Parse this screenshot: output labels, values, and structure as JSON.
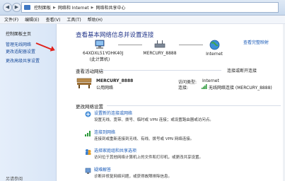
{
  "window": {
    "breadcrumb": [
      "控制面板",
      "网络和 Internet",
      "网络和共享中心"
    ]
  },
  "menu": [
    "文件(F)",
    "编辑(E)",
    "查看(V)",
    "工具(T)",
    "帮助(H)"
  ],
  "sidebar": {
    "items": [
      "控制面板主页",
      "管理无线网络",
      "更改适配器设置",
      "更改高级共享设置"
    ],
    "see_also": "另请参阅"
  },
  "main": {
    "title": "查看基本网络信息并设置连接",
    "full_map": "查看完整映射",
    "map": {
      "computer": "64XDXL51YOHK40J",
      "computer_sub": "(此计算机)",
      "router": "MERCURY_8888",
      "internet": "Internet"
    },
    "active_header": "查看活动网络",
    "connect_disconnect": "连接或断开连接",
    "network": {
      "name": "MERCURY_8888",
      "type": "公用网络",
      "access_label": "访问类型:",
      "access_value": "Internet",
      "conn_label": "连接:",
      "conn_value": "无线网络连接 (MERCURY_8888)"
    },
    "change_header": "更改网络设置",
    "tasks": [
      {
        "title": "设置新的连接或网络",
        "desc": "设置无线、宽带、拨号、临时或 VPN 连接；或设置路由器或访问点。"
      },
      {
        "title": "连接到网络",
        "desc": "连接到或重新连接到无线、有线、拨号或 VPN 网络连接。"
      },
      {
        "title": "选择家庭组和共享选项",
        "desc": "访问位于其他网络计算机上的文件和打印机，或更改共享设置。"
      },
      {
        "title": "疑难解答",
        "desc": "诊断并修复网络问题，或获得故障排除信息。"
      }
    ]
  },
  "colors": {
    "accent": "#1a5bb8",
    "title": "#1e3287",
    "arrow": "#e0201a"
  }
}
